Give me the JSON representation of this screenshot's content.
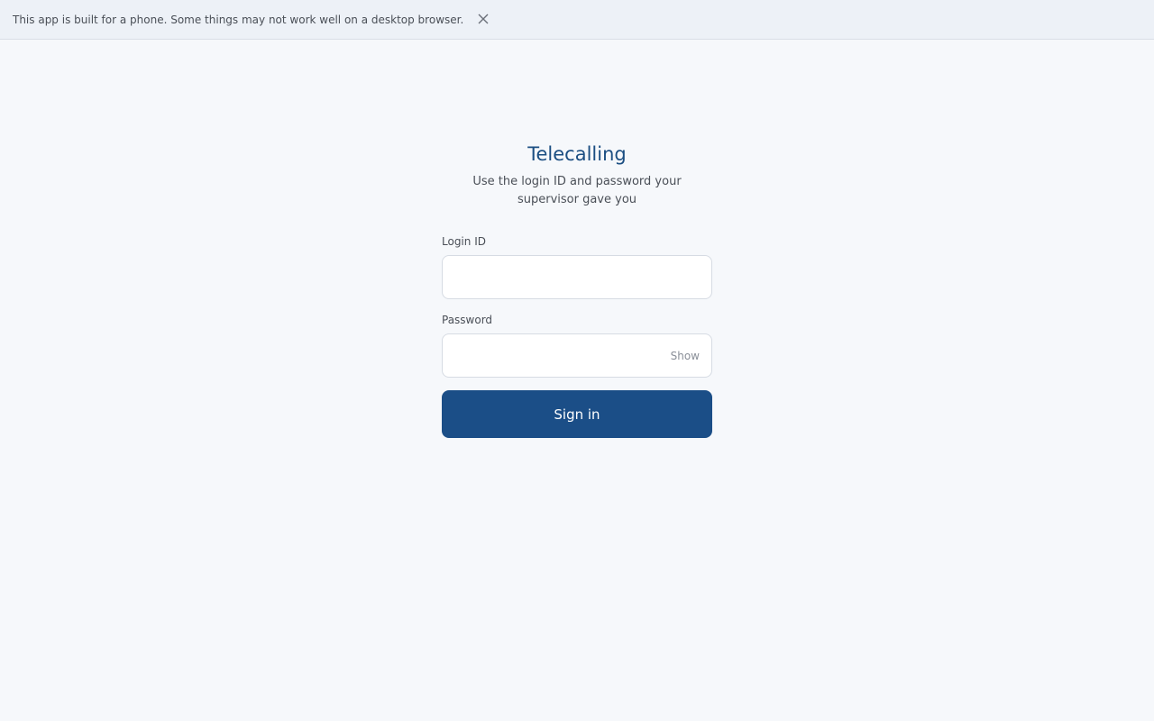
{
  "banner": {
    "message": "This app is built for a phone. Some things may not work well on a desktop browser.",
    "close_icon": "close-icon"
  },
  "login": {
    "title": "Telecalling",
    "subtitle": "Use the login ID and password your supervisor gave you",
    "login_id_label": "Login ID",
    "login_id_value": "",
    "password_label": "Password",
    "password_value": "",
    "show_label": "Show",
    "signin_label": "Sign in"
  },
  "colors": {
    "accent": "#1b4e87",
    "title": "#1b4e82",
    "background": "#f6f8fb",
    "banner_background": "#edf1f7"
  }
}
